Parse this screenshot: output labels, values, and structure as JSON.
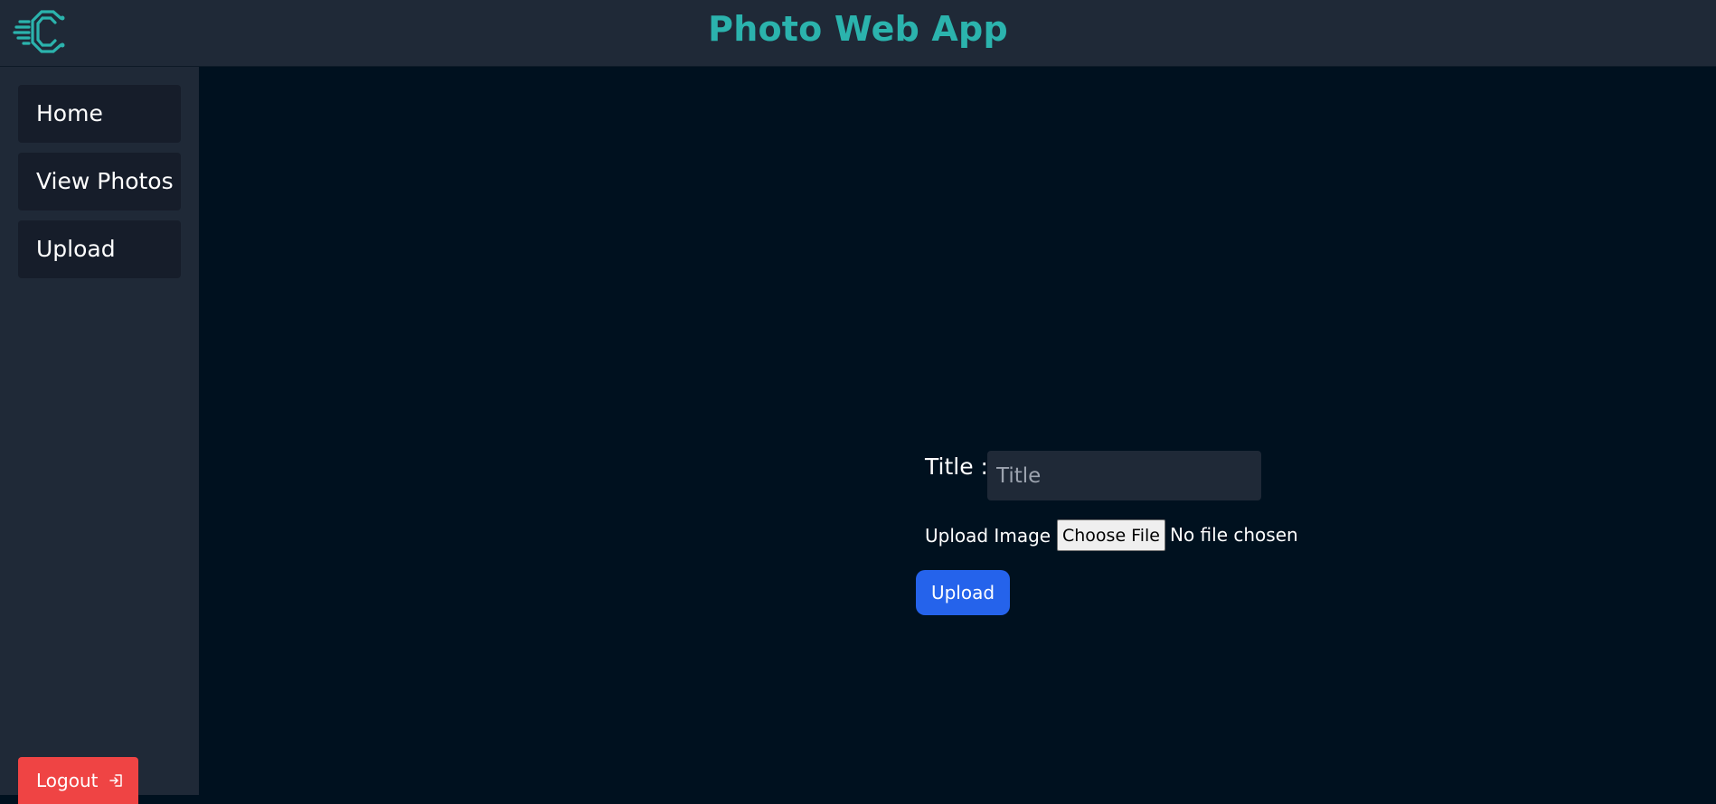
{
  "header": {
    "title": "Photo Web App",
    "logo_icon": "code-c-logo-icon",
    "title_color": "#2bb3ad",
    "background": "#1f2937"
  },
  "sidebar": {
    "items": [
      {
        "label": "Home"
      },
      {
        "label": "View Photos"
      },
      {
        "label": "Upload"
      }
    ],
    "logout_label": "Logout",
    "logout_icon": "logout-icon",
    "logout_color": "#ef4444"
  },
  "form": {
    "title_label": "Title :",
    "title_placeholder": "Title",
    "title_value": "",
    "upload_image_label": "Upload Image :",
    "choose_file_label": "Choose File",
    "no_file_text": "No file chosen",
    "submit_label": "Upload",
    "submit_color": "#2563eb"
  }
}
